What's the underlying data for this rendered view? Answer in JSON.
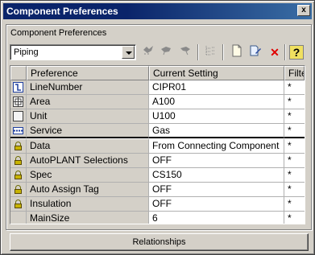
{
  "window": {
    "title": "Component Preferences",
    "close_label": "x"
  },
  "group_label": "Component Preferences",
  "category_select": {
    "value": "Piping"
  },
  "grid": {
    "headers": [
      "Preference",
      "Current Setting",
      "Filter"
    ],
    "rows": [
      {
        "icon": "linenumber-icon",
        "pref": "LineNumber",
        "setting": "CIPR01",
        "filter": "*"
      },
      {
        "icon": "area-icon",
        "pref": "Area",
        "setting": "A100",
        "filter": "*"
      },
      {
        "icon": "unit-icon",
        "pref": "Unit",
        "setting": "U100",
        "filter": "*"
      },
      {
        "icon": "service-icon",
        "pref": "Service",
        "setting": "Gas",
        "filter": "*"
      },
      {
        "icon": "lock-icon",
        "pref": "Data",
        "setting": "From Connecting Component",
        "filter": "*"
      },
      {
        "icon": "lock-icon",
        "pref": "AutoPLANT Selections",
        "setting": "OFF",
        "filter": "*"
      },
      {
        "icon": "lock-icon",
        "pref": "Spec",
        "setting": "CS150",
        "filter": "*"
      },
      {
        "icon": "lock-icon",
        "pref": "Auto Assign Tag",
        "setting": "OFF",
        "filter": "*"
      },
      {
        "icon": "lock-icon",
        "pref": "Insulation",
        "setting": "OFF",
        "filter": "*"
      },
      {
        "icon": "",
        "pref": "MainSize",
        "setting": "6",
        "filter": "*"
      }
    ]
  },
  "toolbar": {
    "icons": [
      "bird-icon-1",
      "bird-icon-2",
      "bird-icon-3",
      "tree-icon",
      "new-doc-icon",
      "edit-doc-icon",
      "delete-icon",
      "help-icon"
    ],
    "help_label": "?",
    "delete_label": "✕"
  },
  "relationships_button": "Relationships"
}
